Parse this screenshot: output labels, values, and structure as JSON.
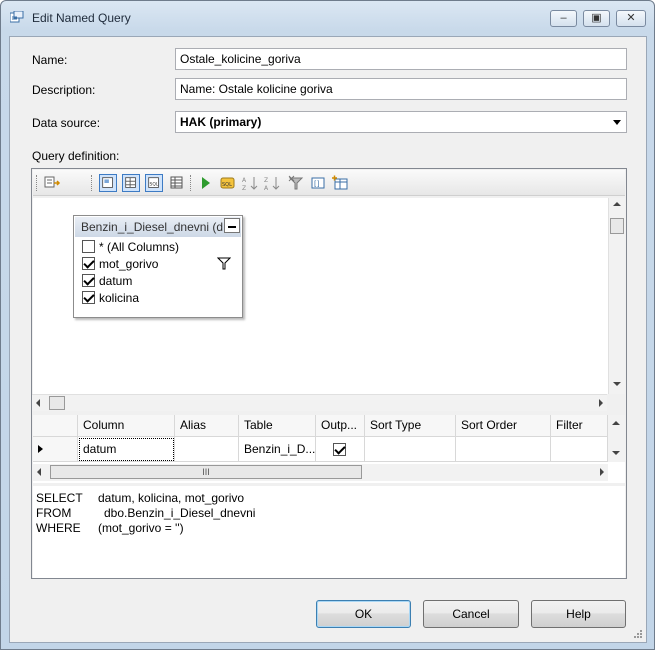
{
  "window": {
    "title": "Edit Named Query"
  },
  "form": {
    "name_label": "Name:",
    "name_value": "Ostale_kolicine_goriva",
    "description_label": "Description:",
    "description_value": "Name: Ostale kolicine goriva",
    "datasource_label": "Data source:",
    "datasource_value": "HAK (primary)",
    "query_label": "Query definition:"
  },
  "toolbar": {
    "icons": [
      "manage-relationships-icon",
      "show-diagram-pane-icon",
      "show-grid-pane-icon",
      "show-sql-pane-icon",
      "show-results-pane-icon",
      "run-query-icon",
      "verify-sql-icon",
      "sort-ascending-icon",
      "sort-descending-icon",
      "remove-filter-icon",
      "use-group-by-icon",
      "add-table-icon"
    ]
  },
  "diagram": {
    "table_title": "Benzin_i_Diesel_dnevni (d",
    "columns": [
      {
        "label": "* (All Columns)",
        "checked": false
      },
      {
        "label": "mot_gorivo",
        "checked": true
      },
      {
        "label": "datum",
        "checked": true
      },
      {
        "label": "kolicina",
        "checked": true
      }
    ]
  },
  "grid": {
    "headers": [
      "Column",
      "Alias",
      "Table",
      "Outp...",
      "Sort Type",
      "Sort Order",
      "Filter"
    ],
    "row": {
      "column": "datum",
      "alias": "",
      "table": "Benzin_i_D...",
      "output": true
    },
    "scroll_mark": "III"
  },
  "sql": {
    "line1_kw": "SELECT",
    "line1_val": "datum, kolicina, mot_gorivo",
    "line2_kw": "FROM",
    "line2_val": "dbo.Benzin_i_Diesel_dnevni",
    "line3_kw": "WHERE",
    "line3_val": "(mot_gorivo = '')"
  },
  "buttons": {
    "ok": "OK",
    "cancel": "Cancel",
    "help": "Help"
  }
}
